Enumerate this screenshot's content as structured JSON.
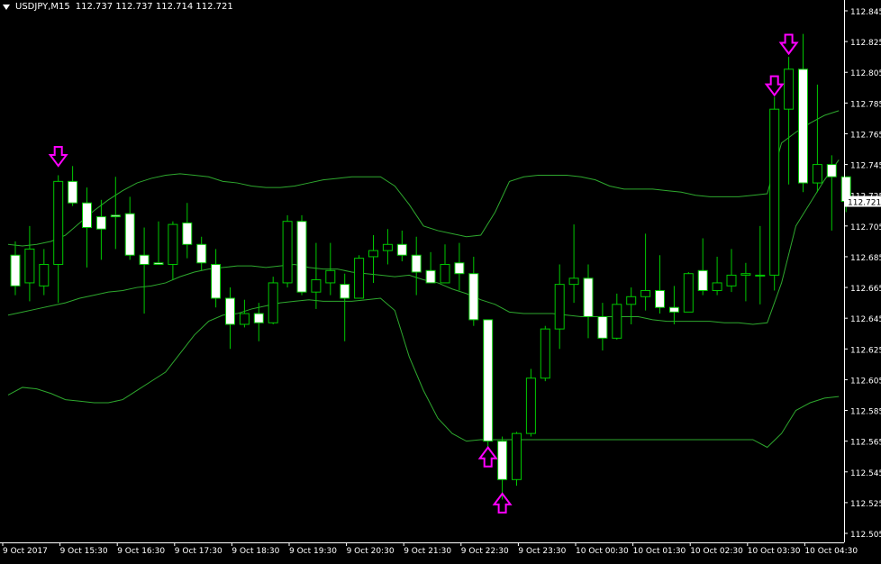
{
  "window": {
    "symbol": "USDJPY,M15",
    "ohlc": "112.737 112.737 112.714 112.721",
    "current_price": "112.721"
  },
  "colors": {
    "background": "#000000",
    "axis": "#ffffff",
    "text": "#ffffff",
    "bull_body": "#000000",
    "bear_body": "#ffffff",
    "candle_outline": "#00c800",
    "wick": "#00c800",
    "bands": "#2ea82e",
    "arrow": "#ff00ff",
    "price_tag_bg": "#ffffff",
    "price_tag_text": "#000000"
  },
  "chart_data": {
    "type": "candlestick",
    "y_ticks": [
      "112.845",
      "112.825",
      "112.805",
      "112.785",
      "112.765",
      "112.745",
      "112.725",
      "112.705",
      "112.685",
      "112.665",
      "112.645",
      "112.625",
      "112.605",
      "112.585",
      "112.565",
      "112.545",
      "112.525",
      "112.505"
    ],
    "ylim": [
      112.5,
      112.85
    ],
    "x_ticks": [
      {
        "label": "9 Oct 2017",
        "index": 0
      },
      {
        "label": "9 Oct 15:30",
        "index": 4
      },
      {
        "label": "9 Oct 16:30",
        "index": 8
      },
      {
        "label": "9 Oct 17:30",
        "index": 12
      },
      {
        "label": "9 Oct 18:30",
        "index": 16
      },
      {
        "label": "9 Oct 19:30",
        "index": 20
      },
      {
        "label": "9 Oct 20:30",
        "index": 24
      },
      {
        "label": "9 Oct 21:30",
        "index": 28
      },
      {
        "label": "9 Oct 22:30",
        "index": 32
      },
      {
        "label": "9 Oct 23:30",
        "index": 36
      },
      {
        "label": "10 Oct 00:30",
        "index": 40
      },
      {
        "label": "10 Oct 01:30",
        "index": 44
      },
      {
        "label": "10 Oct 02:30",
        "index": 48
      },
      {
        "label": "10 Oct 03:30",
        "index": 52
      },
      {
        "label": "10 Oct 04:30",
        "index": 56
      }
    ],
    "candles": [
      {
        "o": 112.686,
        "h": 112.695,
        "l": 112.66,
        "c": 112.666
      },
      {
        "o": 112.668,
        "h": 112.705,
        "l": 112.656,
        "c": 112.69
      },
      {
        "o": 112.666,
        "h": 112.69,
        "l": 112.66,
        "c": 112.68
      },
      {
        "o": 112.68,
        "h": 112.738,
        "l": 112.655,
        "c": 112.734
      },
      {
        "o": 112.734,
        "h": 112.744,
        "l": 112.718,
        "c": 112.72
      },
      {
        "o": 112.72,
        "h": 112.73,
        "l": 112.678,
        "c": 112.704
      },
      {
        "o": 112.711,
        "h": 112.722,
        "l": 112.683,
        "c": 112.703
      },
      {
        "o": 112.712,
        "h": 112.737,
        "l": 112.69,
        "c": 112.711
      },
      {
        "o": 112.713,
        "h": 112.724,
        "l": 112.683,
        "c": 112.686
      },
      {
        "o": 112.686,
        "h": 112.704,
        "l": 112.648,
        "c": 112.68
      },
      {
        "o": 112.681,
        "h": 112.708,
        "l": 112.68,
        "c": 112.68
      },
      {
        "o": 112.68,
        "h": 112.708,
        "l": 112.67,
        "c": 112.706
      },
      {
        "o": 112.707,
        "h": 112.72,
        "l": 112.684,
        "c": 112.693
      },
      {
        "o": 112.693,
        "h": 112.698,
        "l": 112.676,
        "c": 112.681
      },
      {
        "o": 112.68,
        "h": 112.69,
        "l": 112.652,
        "c": 112.658
      },
      {
        "o": 112.658,
        "h": 112.665,
        "l": 112.625,
        "c": 112.641
      },
      {
        "o": 112.641,
        "h": 112.657,
        "l": 112.639,
        "c": 112.648
      },
      {
        "o": 112.648,
        "h": 112.655,
        "l": 112.63,
        "c": 112.642
      },
      {
        "o": 112.642,
        "h": 112.672,
        "l": 112.641,
        "c": 112.668
      },
      {
        "o": 112.668,
        "h": 112.712,
        "l": 112.665,
        "c": 112.708
      },
      {
        "o": 112.708,
        "h": 112.712,
        "l": 112.66,
        "c": 112.662
      },
      {
        "o": 112.662,
        "h": 112.694,
        "l": 112.651,
        "c": 112.67
      },
      {
        "o": 112.668,
        "h": 112.694,
        "l": 112.66,
        "c": 112.676
      },
      {
        "o": 112.667,
        "h": 112.674,
        "l": 112.63,
        "c": 112.658
      },
      {
        "o": 112.658,
        "h": 112.686,
        "l": 112.66,
        "c": 112.684
      },
      {
        "o": 112.685,
        "h": 112.699,
        "l": 112.668,
        "c": 112.689
      },
      {
        "o": 112.689,
        "h": 112.703,
        "l": 112.68,
        "c": 112.693
      },
      {
        "o": 112.693,
        "h": 112.702,
        "l": 112.682,
        "c": 112.686
      },
      {
        "o": 112.686,
        "h": 112.698,
        "l": 112.66,
        "c": 112.675
      },
      {
        "o": 112.676,
        "h": 112.688,
        "l": 112.672,
        "c": 112.668
      },
      {
        "o": 112.668,
        "h": 112.693,
        "l": 112.668,
        "c": 112.68
      },
      {
        "o": 112.681,
        "h": 112.694,
        "l": 112.663,
        "c": 112.674
      },
      {
        "o": 112.674,
        "h": 112.685,
        "l": 112.64,
        "c": 112.644
      },
      {
        "o": 112.644,
        "h": 112.644,
        "l": 112.56,
        "c": 112.565
      },
      {
        "o": 112.565,
        "h": 112.568,
        "l": 112.527,
        "c": 112.54
      },
      {
        "o": 112.54,
        "h": 112.571,
        "l": 112.536,
        "c": 112.57
      },
      {
        "o": 112.57,
        "h": 112.612,
        "l": 112.568,
        "c": 112.606
      },
      {
        "o": 112.606,
        "h": 112.64,
        "l": 112.604,
        "c": 112.638
      },
      {
        "o": 112.638,
        "h": 112.68,
        "l": 112.625,
        "c": 112.667
      },
      {
        "o": 112.667,
        "h": 112.706,
        "l": 112.655,
        "c": 112.671
      },
      {
        "o": 112.671,
        "h": 112.68,
        "l": 112.632,
        "c": 112.646
      },
      {
        "o": 112.646,
        "h": 112.655,
        "l": 112.624,
        "c": 112.632
      },
      {
        "o": 112.632,
        "h": 112.661,
        "l": 112.631,
        "c": 112.654
      },
      {
        "o": 112.654,
        "h": 112.665,
        "l": 112.641,
        "c": 112.659
      },
      {
        "o": 112.659,
        "h": 112.7,
        "l": 112.65,
        "c": 112.663
      },
      {
        "o": 112.663,
        "h": 112.686,
        "l": 112.648,
        "c": 112.652
      },
      {
        "o": 112.652,
        "h": 112.666,
        "l": 112.641,
        "c": 112.649
      },
      {
        "o": 112.649,
        "h": 112.675,
        "l": 112.653,
        "c": 112.674
      },
      {
        "o": 112.676,
        "h": 112.697,
        "l": 112.66,
        "c": 112.663
      },
      {
        "o": 112.663,
        "h": 112.685,
        "l": 112.66,
        "c": 112.668
      },
      {
        "o": 112.666,
        "h": 112.69,
        "l": 112.662,
        "c": 112.673
      },
      {
        "o": 112.673,
        "h": 112.681,
        "l": 112.656,
        "c": 112.674
      },
      {
        "o": 112.673,
        "h": 112.705,
        "l": 112.654,
        "c": 112.673
      },
      {
        "o": 112.673,
        "h": 112.789,
        "l": 112.663,
        "c": 112.781
      },
      {
        "o": 112.781,
        "h": 112.815,
        "l": 112.732,
        "c": 112.807
      },
      {
        "o": 112.807,
        "h": 112.83,
        "l": 112.727,
        "c": 112.733
      },
      {
        "o": 112.733,
        "h": 112.797,
        "l": 112.727,
        "c": 112.745
      },
      {
        "o": 112.745,
        "h": 112.751,
        "l": 112.702,
        "c": 112.737
      },
      {
        "o": 112.737,
        "h": 112.737,
        "l": 112.714,
        "c": 112.721
      }
    ],
    "bands": {
      "upper": [
        112.693,
        112.692,
        112.693,
        112.695,
        112.699,
        112.707,
        112.715,
        112.722,
        112.728,
        112.733,
        112.736,
        112.738,
        112.739,
        112.738,
        112.737,
        112.734,
        112.733,
        112.731,
        112.73,
        112.73,
        112.731,
        112.733,
        112.735,
        112.736,
        112.737,
        112.737,
        112.737,
        112.731,
        112.719,
        112.705,
        112.702,
        112.7,
        112.698,
        112.699,
        112.714,
        112.734,
        112.737,
        112.738,
        112.738,
        112.738,
        112.737,
        112.735,
        112.731,
        112.729,
        112.729,
        112.729,
        112.728,
        112.727,
        112.725,
        112.724,
        112.724,
        112.724,
        112.725,
        112.726,
        112.759,
        112.766,
        112.772,
        112.777,
        112.78
      ],
      "middle": [
        112.647,
        112.649,
        112.651,
        112.653,
        112.655,
        112.658,
        112.66,
        112.662,
        112.663,
        112.665,
        112.666,
        112.668,
        112.672,
        112.675,
        112.677,
        112.678,
        112.679,
        112.679,
        112.678,
        112.679,
        112.68,
        112.678,
        112.677,
        112.677,
        112.675,
        112.674,
        112.673,
        112.672,
        112.673,
        112.67,
        112.668,
        112.664,
        112.661,
        112.657,
        112.654,
        112.649,
        112.648,
        112.648,
        112.648,
        112.647,
        112.646,
        112.646,
        112.646,
        112.646,
        112.646,
        112.644,
        112.643,
        112.643,
        112.643,
        112.643,
        112.642,
        112.642,
        112.641,
        112.642,
        112.668,
        112.705,
        112.72,
        112.735,
        112.748
      ],
      "lower": [
        112.595,
        112.6,
        112.599,
        112.596,
        112.592,
        112.591,
        112.59,
        112.59,
        112.592,
        112.598,
        112.604,
        112.61,
        112.622,
        112.634,
        112.643,
        112.647,
        112.648,
        112.651,
        112.653,
        112.655,
        112.656,
        112.657,
        112.656,
        112.656,
        112.656,
        112.657,
        112.658,
        112.65,
        112.62,
        112.598,
        112.58,
        112.57,
        112.565,
        112.566,
        112.566,
        112.566,
        112.566,
        112.566,
        112.566,
        112.566,
        112.566,
        112.566,
        112.566,
        112.566,
        112.566,
        112.566,
        112.566,
        112.566,
        112.566,
        112.566,
        112.566,
        112.566,
        112.566,
        112.561,
        112.57,
        112.585,
        112.59,
        112.593,
        112.594
      ]
    },
    "arrows": [
      {
        "index": 3,
        "dir": "down",
        "price": 112.75
      },
      {
        "index": 33,
        "dir": "up",
        "price": 112.555
      },
      {
        "index": 34,
        "dir": "up",
        "price": 112.525
      },
      {
        "index": 53,
        "dir": "down",
        "price": 112.796
      },
      {
        "index": 54,
        "dir": "down",
        "price": 112.823
      }
    ],
    "grid": false,
    "legend": "none"
  }
}
